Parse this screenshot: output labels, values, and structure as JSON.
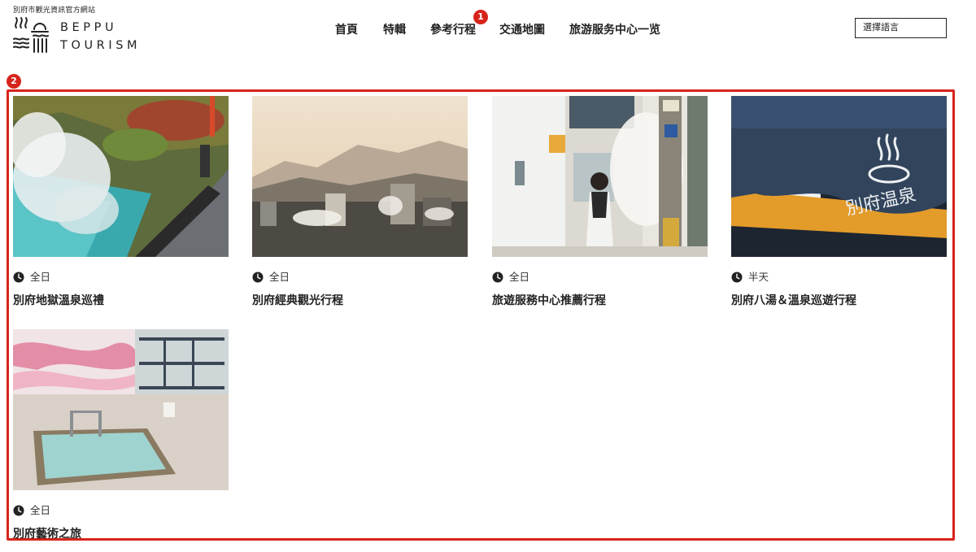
{
  "header": {
    "tagline": "別府市觀光資訊官方網站",
    "logo_line1": "BEPPU",
    "logo_line2": "TOURISM",
    "language_select": "選擇語言"
  },
  "nav": {
    "items": [
      {
        "label": "首頁"
      },
      {
        "label": "特輯"
      },
      {
        "label": "參考行程"
      },
      {
        "label": "交通地圖"
      },
      {
        "label": "旅游服务中心一览"
      }
    ]
  },
  "markers": {
    "m1": "1",
    "m2": "2"
  },
  "courses": [
    {
      "duration": "全日",
      "title": "別府地獄溫泉巡禮"
    },
    {
      "duration": "全日",
      "title": "別府經典觀光行程"
    },
    {
      "duration": "全日",
      "title": "旅遊服務中心推薦行程"
    },
    {
      "duration": "半天",
      "title": "別府八湯＆溫泉巡遊行程"
    },
    {
      "duration": "全日",
      "title": "別府藝術之旅"
    }
  ],
  "colors": {
    "accent_red": "#d7241b",
    "text": "#222222"
  },
  "icons": {
    "duration": "clock-icon",
    "logo": "steam-waves-logo"
  }
}
